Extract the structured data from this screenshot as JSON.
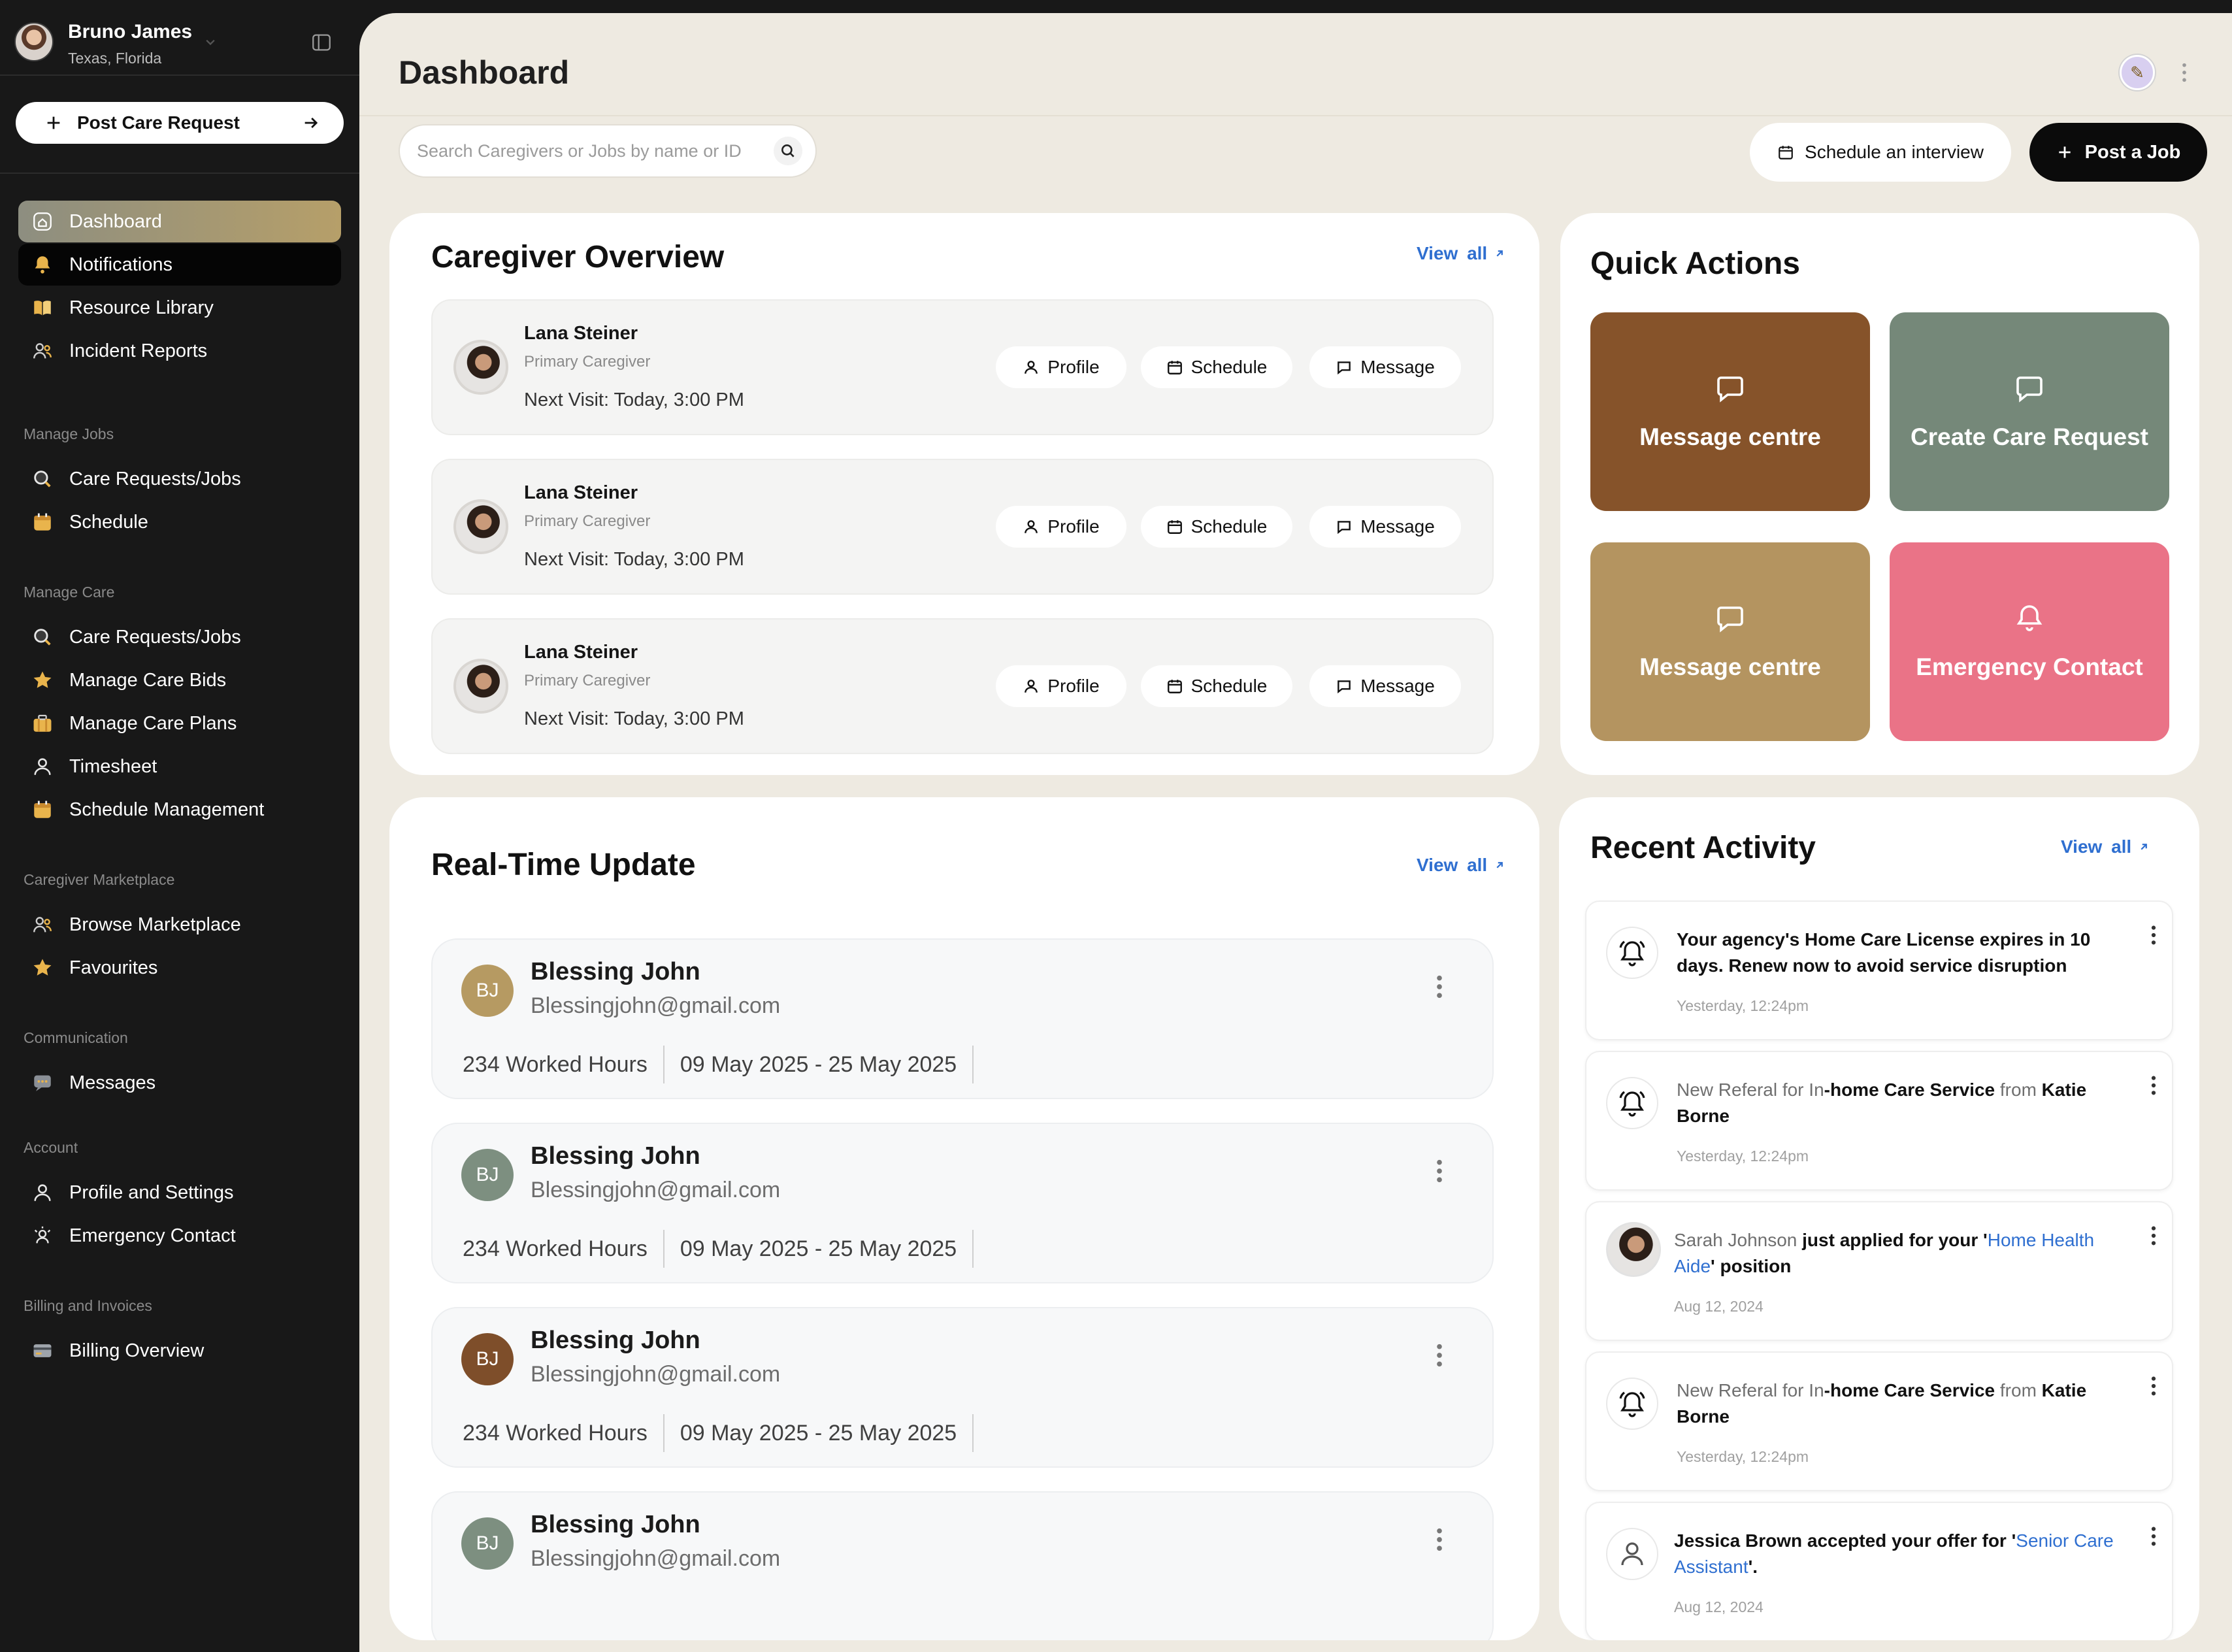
{
  "sidebar": {
    "user": {
      "name": "Bruno James",
      "location": "Texas, Florida"
    },
    "post_care_label": "Post Care Request",
    "main_items": [
      {
        "label": "Dashboard",
        "icon": "home-icon"
      },
      {
        "label": "Notifications",
        "icon": "bell-icon"
      },
      {
        "label": "Resource Library",
        "icon": "book-icon"
      },
      {
        "label": "Incident Reports",
        "icon": "users-icon"
      }
    ],
    "sections": [
      {
        "title": "Manage Jobs",
        "items": [
          {
            "label": "Care Requests/Jobs",
            "icon": "search-icon"
          },
          {
            "label": "Schedule",
            "icon": "calendar-icon"
          }
        ]
      },
      {
        "title": "Manage Care",
        "items": [
          {
            "label": "Care Requests/Jobs",
            "icon": "search-icon"
          },
          {
            "label": "Manage Care Bids",
            "icon": "star-icon"
          },
          {
            "label": "Manage Care Plans",
            "icon": "briefcase-icon"
          },
          {
            "label": "Timesheet",
            "icon": "user-icon"
          },
          {
            "label": "Schedule Management",
            "icon": "calendar-icon"
          }
        ]
      },
      {
        "title": "Caregiver Marketplace",
        "items": [
          {
            "label": "Browse Marketplace",
            "icon": "users-icon"
          },
          {
            "label": "Favourites",
            "icon": "star-icon"
          }
        ]
      },
      {
        "title": "Communication",
        "items": [
          {
            "label": "Messages",
            "icon": "chat-icon"
          }
        ]
      },
      {
        "title": "Account",
        "items": [
          {
            "label": "Profile and Settings",
            "icon": "user-icon"
          },
          {
            "label": "Emergency Contact",
            "icon": "emergency-icon"
          }
        ]
      },
      {
        "title": "Billing and Invoices",
        "items": [
          {
            "label": "Billing Overview",
            "icon": "card-icon"
          }
        ]
      }
    ]
  },
  "header": {
    "title": "Dashboard",
    "search_placeholder": "Search Caregivers or Jobs by name or ID",
    "schedule_interview_label": "Schedule an interview",
    "post_job_label": "Post a Job"
  },
  "caregiver_overview": {
    "title": "Caregiver Overview",
    "view_all": "View all",
    "rows": [
      {
        "name": "Lana Steiner",
        "role": "Primary Caregiver",
        "next_visit": "Next Visit: Today, 3:00 PM"
      },
      {
        "name": "Lana Steiner",
        "role": "Primary Caregiver",
        "next_visit": "Next Visit: Today, 3:00 PM"
      },
      {
        "name": "Lana Steiner",
        "role": "Primary Caregiver",
        "next_visit": "Next Visit: Today, 3:00 PM"
      }
    ],
    "actions": {
      "profile": "Profile",
      "schedule": "Schedule",
      "message": "Message"
    }
  },
  "quick_actions": {
    "title": "Quick Actions",
    "tiles": [
      {
        "label": "Message centre",
        "icon": "chat-bubble-icon",
        "color": "#86532a"
      },
      {
        "label": "Create Care Request",
        "icon": "chat-bubble-icon",
        "color": "#758879"
      },
      {
        "label": "Message centre",
        "icon": "chat-bubble-icon",
        "color": "#b49460"
      },
      {
        "label": "Emergency Contact",
        "icon": "bell-icon",
        "color": "#ea7387"
      }
    ]
  },
  "realtime_update": {
    "title": "Real-Time Update",
    "view_all": "View all",
    "rows": [
      {
        "initials": "BJ",
        "name": "Blessing John",
        "email": "Blessingjohn@gmail.com",
        "hours": "234 Worked Hours",
        "dates": "09 May 2025 - 25 May 2025",
        "color": "#b69a62"
      },
      {
        "initials": "BJ",
        "name": "Blessing John",
        "email": "Blessingjohn@gmail.com",
        "hours": "234 Worked Hours",
        "dates": "09 May 2025 - 25 May 2025",
        "color": "#7d8f80"
      },
      {
        "initials": "BJ",
        "name": "Blessing John",
        "email": "Blessingjohn@gmail.com",
        "hours": "234 Worked Hours",
        "dates": "09 May 2025 - 25 May 2025",
        "color": "#7e4e2a"
      },
      {
        "initials": "BJ",
        "name": "Blessing John",
        "email": "Blessingjohn@gmail.com",
        "hours": "",
        "dates": "",
        "color": "#7d8f80"
      }
    ]
  },
  "recent_activity": {
    "title": "Recent Activity",
    "view_all": "View all",
    "items": [
      {
        "text_bold": "Your agency's Home Care License expires in 10 days. Renew now to avoid service disruption",
        "time": "Yesterday, 12:24pm"
      },
      {
        "p1": "New Referal for In",
        "p2": "-home Care Service",
        "p3": " from ",
        "p4": "Katie Borne",
        "time": "Yesterday, 12:24pm"
      },
      {
        "p1": "Sarah Johnson",
        "p2": " just applied for your '",
        "p3": "Home Health Aide",
        "p4": "' position",
        "time": "Aug 12, 2024"
      },
      {
        "p1": "New Referal for In",
        "p2": "-home Care Service",
        "p3": " from ",
        "p4": "Katie Borne",
        "time": "Yesterday, 12:24pm"
      },
      {
        "p1": "Jessica Brown accepted your offer for '",
        "p2": "Senior Care Assistant",
        "p3": "'.",
        "time": "Aug 12, 2024"
      }
    ]
  },
  "colors": {
    "accent_blue": "#2f6fd0",
    "sidebar_bg": "#181818",
    "main_bg": "#eeeae1",
    "active_nav_gradient": [
      "#8d8e80",
      "#b69f69"
    ]
  }
}
